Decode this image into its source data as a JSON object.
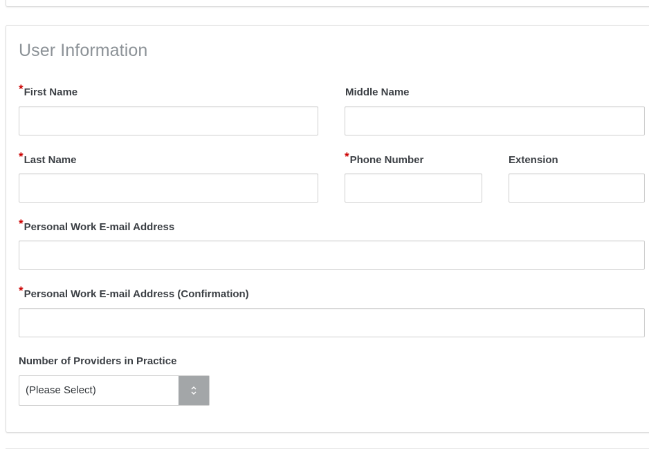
{
  "form": {
    "section_title": "User Information",
    "required_marker": "*",
    "fields": {
      "first_name": {
        "label": "First Name",
        "value": "",
        "required": true
      },
      "middle_name": {
        "label": "Middle Name",
        "value": "",
        "required": false
      },
      "last_name": {
        "label": "Last Name",
        "value": "",
        "required": true
      },
      "phone_number": {
        "label": "Phone Number",
        "value": "",
        "required": true
      },
      "extension": {
        "label": "Extension",
        "value": "",
        "required": false
      },
      "email": {
        "label": "Personal Work E-mail Address",
        "value": "",
        "required": true
      },
      "email_confirm": {
        "label": "Personal Work E-mail Address (Confirmation)",
        "value": "",
        "required": true
      },
      "providers": {
        "label": "Number of Providers in Practice",
        "selected": "(Please Select)",
        "required": false
      }
    }
  },
  "icons": {
    "select_arrow": "up-down-chevron-icon"
  },
  "colors": {
    "required": "#cc0000",
    "title": "#8c9297",
    "label": "#3b3f44",
    "select_button": "#a3a6a8"
  }
}
